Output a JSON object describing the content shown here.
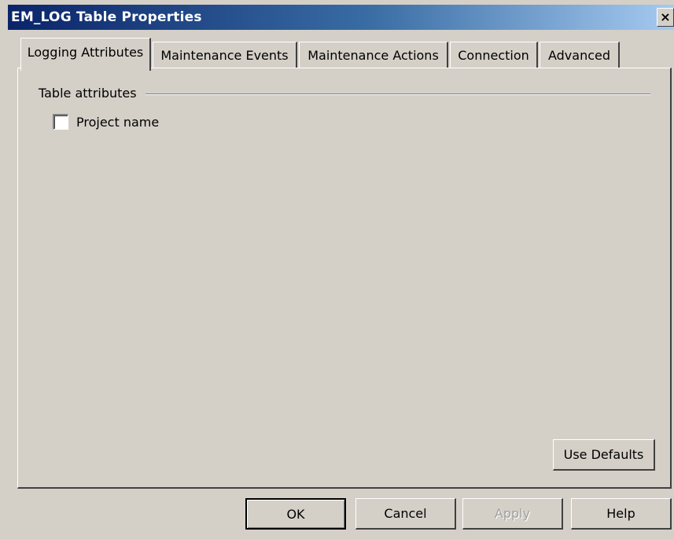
{
  "window": {
    "title": "EM_LOG Table Properties",
    "close_label": "×"
  },
  "tabs": [
    {
      "label": "Logging Attributes",
      "active": true
    },
    {
      "label": "Maintenance Events",
      "active": false
    },
    {
      "label": "Maintenance Actions",
      "active": false
    },
    {
      "label": "Connection",
      "active": false
    },
    {
      "label": "Advanced",
      "active": false
    }
  ],
  "panel": {
    "group_label": "Table attributes",
    "checkbox": {
      "label": "Project name",
      "checked": false
    },
    "use_defaults_label": "Use Defaults"
  },
  "footer": {
    "ok_label": "OK",
    "cancel_label": "Cancel",
    "apply_label": "Apply",
    "help_label": "Help"
  },
  "colors": {
    "titlebar_start": "#0a246a",
    "titlebar_end": "#a6caf0",
    "face": "#d4d0c8"
  }
}
